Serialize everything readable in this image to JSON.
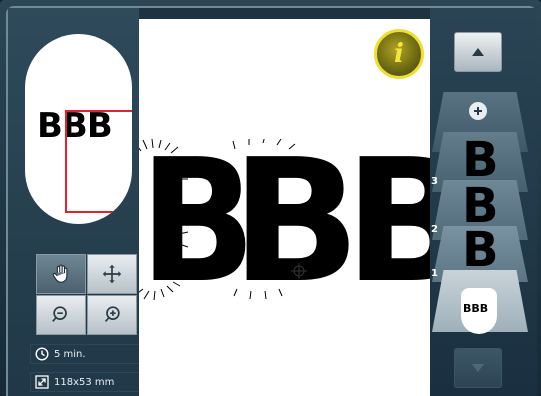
{
  "info_button": {
    "label": "i"
  },
  "preview": {
    "text": "BBB"
  },
  "canvas": {
    "letters": [
      "B",
      "B",
      "B"
    ]
  },
  "tools": [
    {
      "name": "hand-tool",
      "icon": "hand-icon",
      "active": true
    },
    {
      "name": "move-tool",
      "icon": "move-arrows-icon",
      "active": false
    },
    {
      "name": "zoom-out-tool",
      "icon": "zoom-out-icon",
      "active": false
    },
    {
      "name": "zoom-in-tool",
      "icon": "zoom-in-icon",
      "active": false
    }
  ],
  "status": {
    "time": "5 min.",
    "size": "118x53 mm"
  },
  "layers": {
    "items": [
      {
        "number": "3",
        "letter": "B"
      },
      {
        "number": "2",
        "letter": "B"
      },
      {
        "number": "1",
        "letter": "B"
      }
    ],
    "combined_thumbnail": "BBB"
  },
  "colors": {
    "accent_yellow": "#f0df30",
    "preview_frame": "#e3232b"
  }
}
